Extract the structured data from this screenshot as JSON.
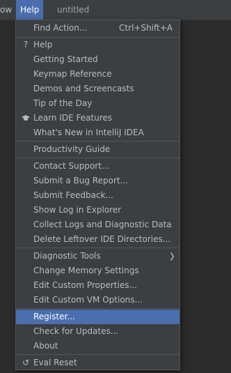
{
  "menubar": {
    "window_label": "ow",
    "help_label": "Help",
    "project_title": "untitled"
  },
  "menu": {
    "find_action": {
      "label": "Find Action...",
      "shortcut": "Ctrl+Shift+A"
    },
    "help": {
      "label": "Help",
      "icon": "question-icon"
    },
    "getting_started": {
      "label": "Getting Started"
    },
    "keymap_reference": {
      "label": "Keymap Reference"
    },
    "demos": {
      "label": "Demos and Screencasts"
    },
    "tip_of_day": {
      "label": "Tip of the Day"
    },
    "learn_ide": {
      "label": "Learn IDE Features",
      "icon": "graduation-cap-icon"
    },
    "whats_new": {
      "label": "What's New in IntelliJ IDEA"
    },
    "productivity_guide": {
      "label": "Productivity Guide"
    },
    "contact_support": {
      "label": "Contact Support..."
    },
    "submit_bug": {
      "label": "Submit a Bug Report..."
    },
    "submit_feedback": {
      "label": "Submit Feedback..."
    },
    "show_log": {
      "label": "Show Log in Explorer"
    },
    "collect_logs": {
      "label": "Collect Logs and Diagnostic Data"
    },
    "delete_leftover": {
      "label": "Delete Leftover IDE Directories..."
    },
    "diagnostic_tools": {
      "label": "Diagnostic Tools"
    },
    "change_memory": {
      "label": "Change Memory Settings"
    },
    "edit_properties": {
      "label": "Edit Custom Properties..."
    },
    "edit_vm_options": {
      "label": "Edit Custom VM Options..."
    },
    "register": {
      "label": "Register..."
    },
    "check_updates": {
      "label": "Check for Updates..."
    },
    "about": {
      "label": "About"
    },
    "eval_reset": {
      "label": "Eval Reset",
      "icon": "undo-icon"
    }
  },
  "colors": {
    "menu_bg": "#3c3f41",
    "selection": "#4b6eaf",
    "text": "#bbbbbb"
  }
}
